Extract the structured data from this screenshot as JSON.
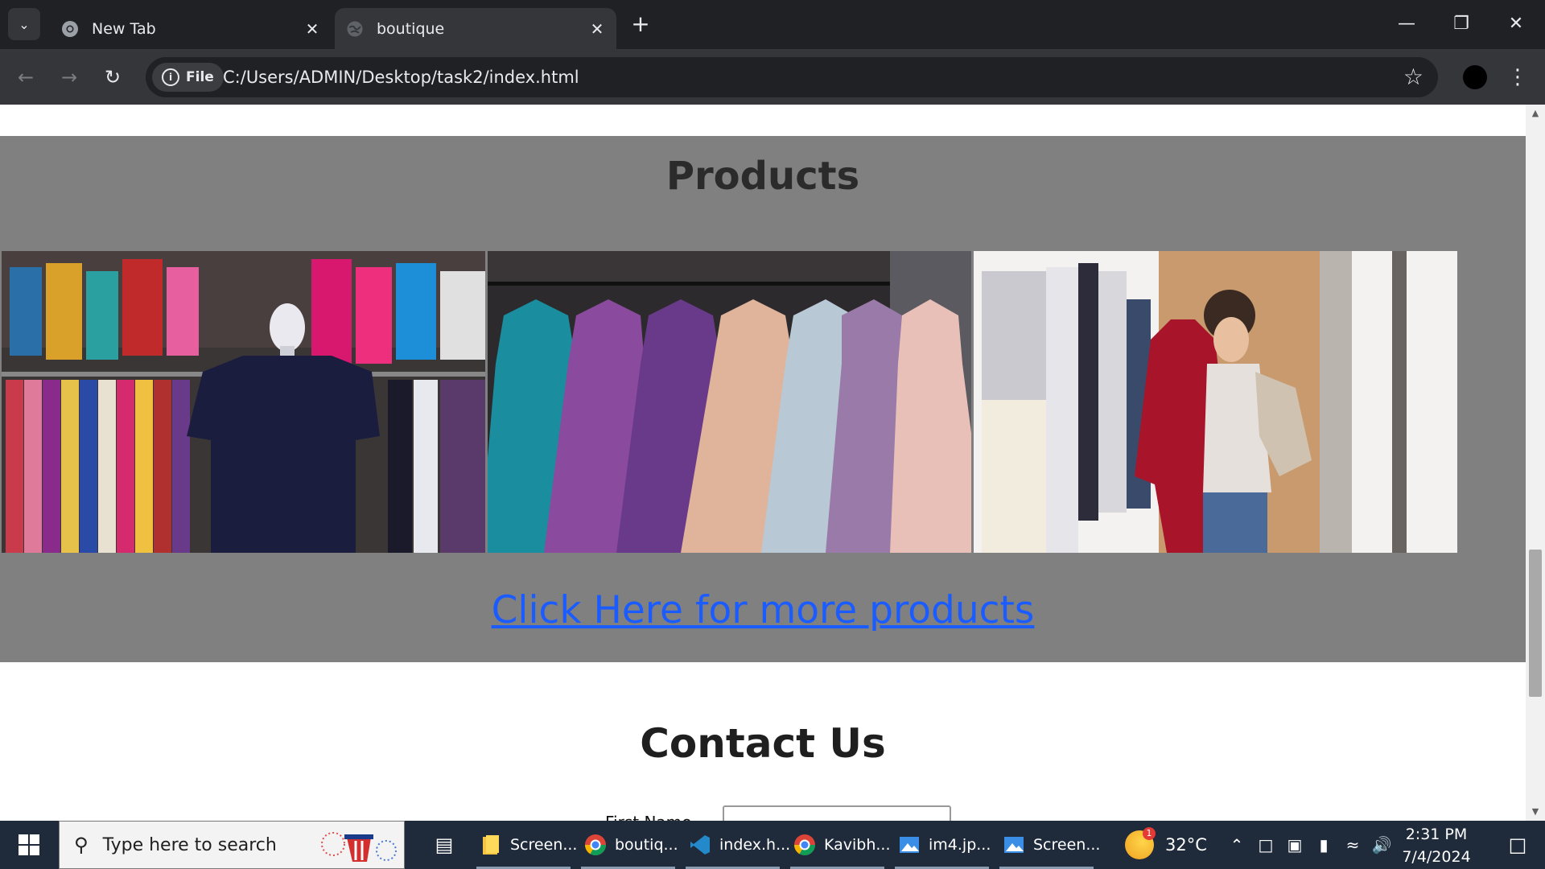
{
  "browser": {
    "tabs": [
      {
        "title": "New Tab",
        "active": false,
        "icon": "chrome-icon"
      },
      {
        "title": "boutique",
        "active": true,
        "icon": "globe-icon"
      }
    ],
    "address_chip": "File",
    "url": "C:/Users/ADMIN/Desktop/task2/index.html",
    "theme_color": "#202124"
  },
  "page": {
    "products_heading": "Products",
    "product_images": [
      {
        "description": "mannequin-with-clothing-racks"
      },
      {
        "description": "evening-gowns-on-rack"
      },
      {
        "description": "woman-shopping-clothes"
      }
    ],
    "more_link": "Click Here for more products",
    "contact_heading": "Contact Us",
    "form_first_label": "First Name",
    "section_bg": "#808080",
    "link_color": "#1a5cff"
  },
  "taskbar": {
    "search_placeholder": "Type here to search",
    "apps": [
      {
        "label": "Screen...",
        "icon": "file-explorer-icon"
      },
      {
        "label": "boutiq...",
        "icon": "chrome-icon"
      },
      {
        "label": "index.h...",
        "icon": "vscode-icon"
      },
      {
        "label": "Kavibh...",
        "icon": "chrome-icon"
      },
      {
        "label": "im4.jp...",
        "icon": "photos-icon"
      },
      {
        "label": "Screen...",
        "icon": "photos-icon"
      }
    ],
    "weather": {
      "temp": "32°C",
      "badge": "1"
    },
    "time": "2:31 PM",
    "date": "7/4/2024"
  }
}
